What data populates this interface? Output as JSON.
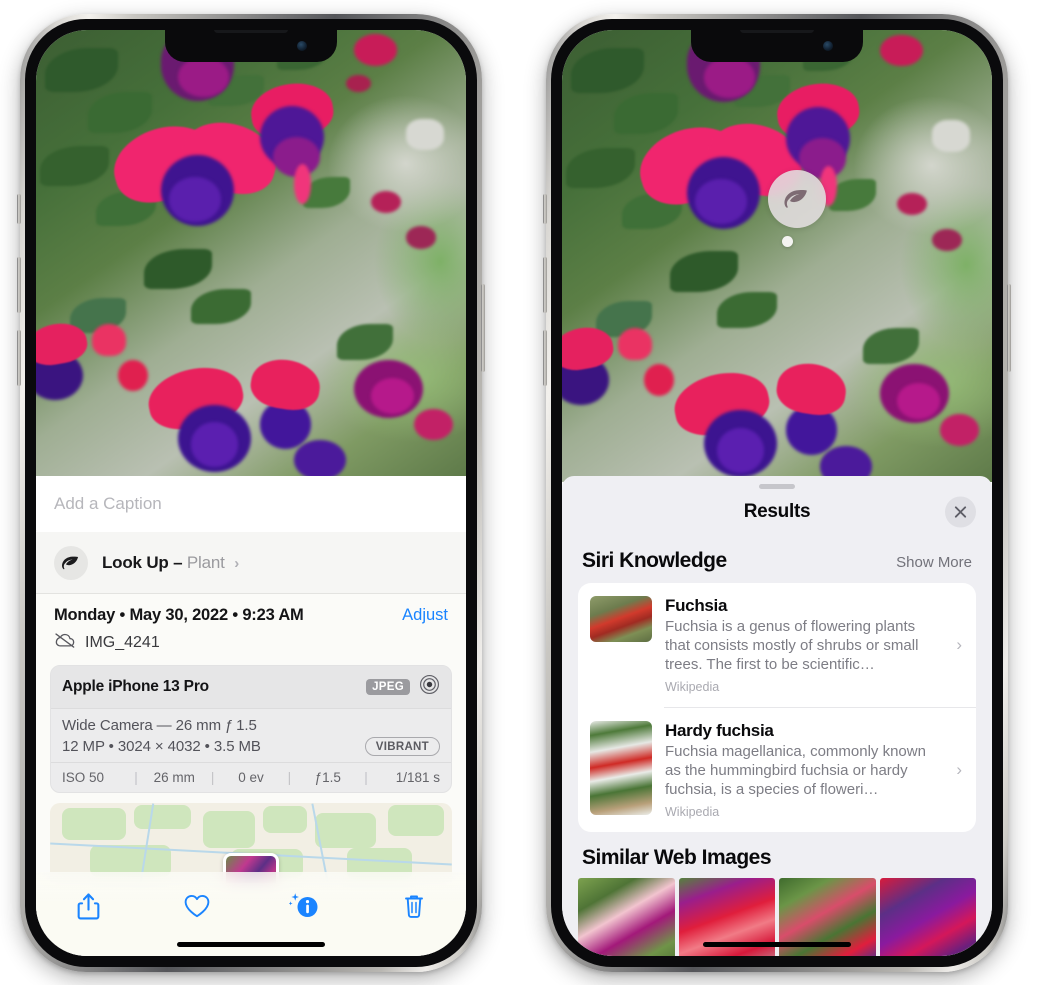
{
  "left_phone": {
    "caption_placeholder": "Add a Caption",
    "lookup": {
      "label": "Look Up",
      "dash": "–",
      "subject": "Plant",
      "chevron": "›",
      "icon": "leaf-icon"
    },
    "meta": {
      "date": "Monday • May 30, 2022 • 9:23 AM",
      "adjust_label": "Adjust",
      "filename": "IMG_4241",
      "cloud_icon": "icloud-slash-icon"
    },
    "exif": {
      "device": "Apple iPhone 13 Pro",
      "format_tag": "JPEG",
      "aperture_icon": "lens-icon",
      "lens_line": "Wide Camera — 26 mm ƒ 1.5",
      "size_line": "12 MP • 3024 × 4032 • 3.5 MB",
      "style_tag": "VIBRANT",
      "values": [
        "ISO 50",
        "26 mm",
        "0 ev",
        "ƒ1.5",
        "1/181 s"
      ],
      "separator": "|"
    },
    "toolbar": [
      {
        "name": "share-button",
        "icon": "share-icon"
      },
      {
        "name": "favorite-button",
        "icon": "heart-icon"
      },
      {
        "name": "info-button",
        "icon": "info-sparkle-icon"
      },
      {
        "name": "delete-button",
        "icon": "trash-icon"
      }
    ],
    "accent_color": "#1a84ff"
  },
  "right_phone": {
    "detect_badge": {
      "icon": "leaf-icon",
      "name": "visual-lookup-badge"
    },
    "sheet": {
      "title": "Results",
      "close_label": "✕",
      "sections": [
        {
          "title": "Siri Knowledge",
          "action": "Show More",
          "items": [
            {
              "title": "Fuchsia",
              "description": "Fuchsia is a genus of flowering plants that consists mostly of shrubs or small trees. The first to be scientific…",
              "source": "Wikipedia",
              "chevron": "›"
            },
            {
              "title": "Hardy fuchsia",
              "description": "Fuchsia magellanica, commonly known as the hummingbird fuchsia or hardy fuchsia, is a species of floweri…",
              "source": "Wikipedia",
              "chevron": "›"
            }
          ]
        },
        {
          "title": "Similar Web Images",
          "action": "",
          "images": [
            "web-image-1",
            "web-image-2",
            "web-image-3",
            "web-image-4"
          ]
        }
      ]
    }
  }
}
